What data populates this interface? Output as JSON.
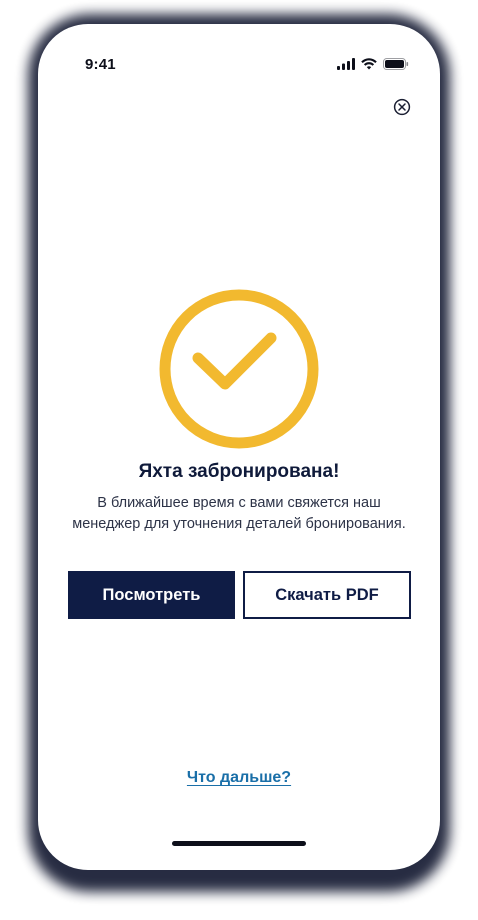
{
  "status_bar": {
    "time": "9:41",
    "icons": [
      "cellular-signal-icon",
      "wifi-icon",
      "battery-icon"
    ]
  },
  "header": {
    "close_icon": "close-circle-icon"
  },
  "success": {
    "icon": "checkmark-circle-icon",
    "accent_color": "#F2B92F",
    "title": "Яхта забронирована!",
    "message": "В ближайшее время с вами свяжется наш менеджер для уточнения деталей бронирования."
  },
  "actions": {
    "view_label": "Посмотреть",
    "download_label": "Скачать PDF",
    "primary_color": "#0F1C45"
  },
  "footer": {
    "next_link": "Что дальше?",
    "link_color": "#1A6FA8"
  }
}
